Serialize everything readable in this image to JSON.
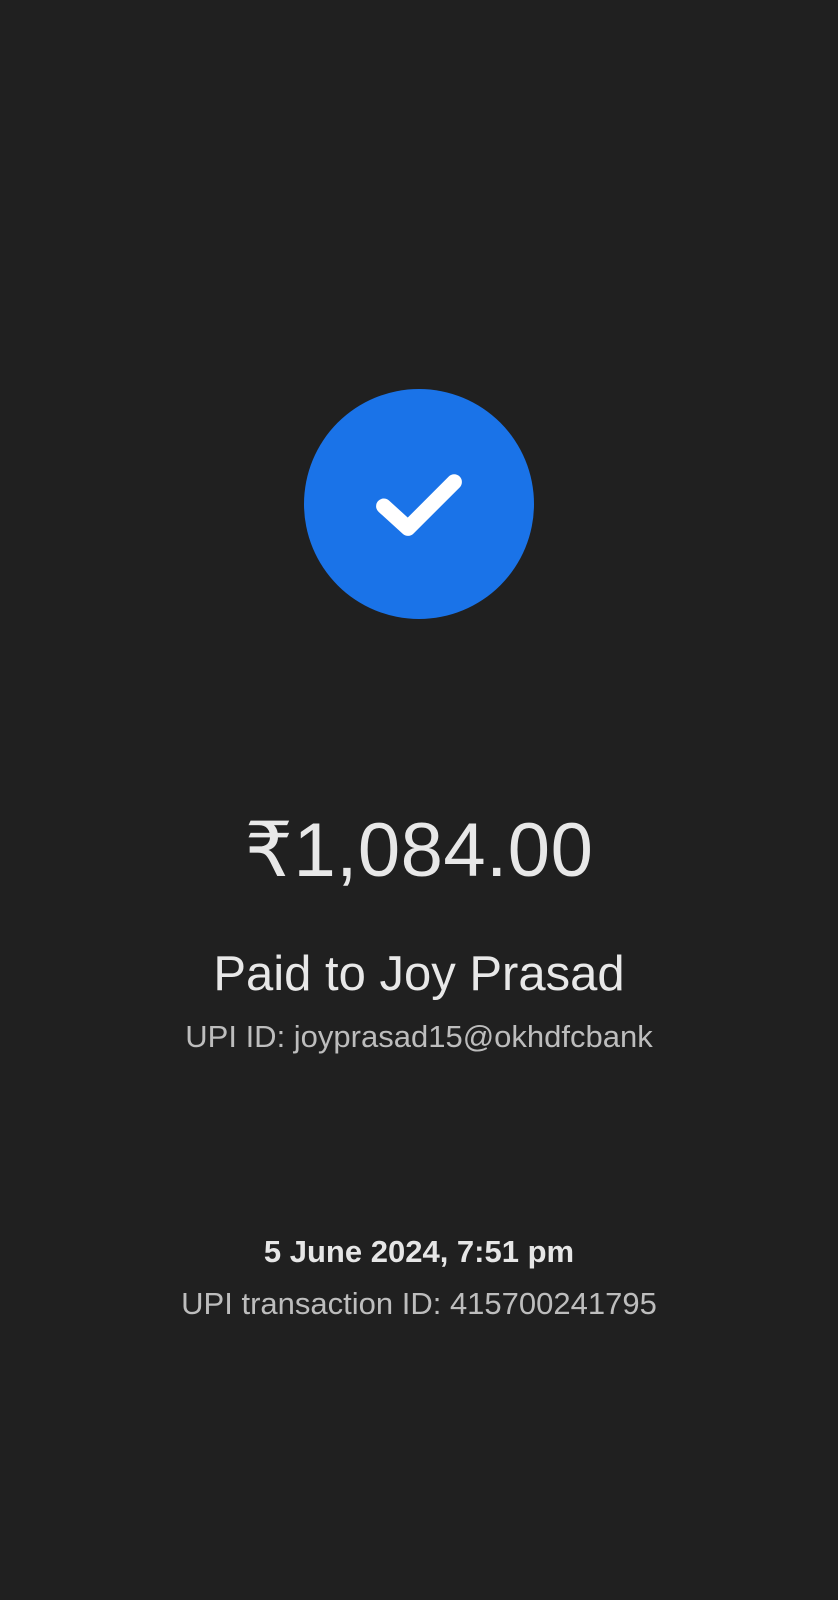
{
  "status": {
    "icon": "check-circle-icon",
    "icon_color": "#1a73e8"
  },
  "payment": {
    "amount": "₹1,084.00",
    "paid_to": "Paid to Joy Prasad",
    "upi_id": "UPI ID: joyprasad15@okhdfcbank"
  },
  "transaction": {
    "datetime": "5 June 2024, 7:51 pm",
    "upi_transaction_id": "UPI transaction ID: 415700241795"
  },
  "theme": {
    "background": "#202020",
    "text": "#e8e8e8",
    "secondary_text": "#bdbdbd"
  }
}
